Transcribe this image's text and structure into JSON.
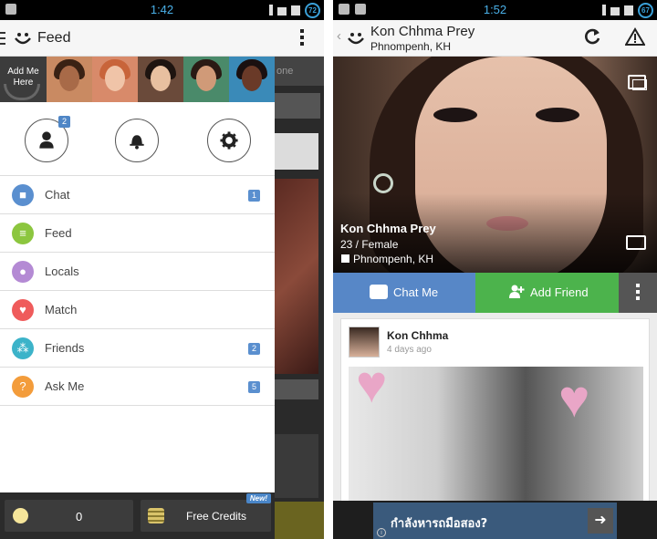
{
  "left": {
    "status": {
      "time": "1:42",
      "battery": "72"
    },
    "appbar": {
      "title": "Feed"
    },
    "background_tab": "one",
    "strip": {
      "add_me": "Add Me Here"
    },
    "quick_actions": {
      "friend_requests_badge": "2"
    },
    "menu": [
      {
        "label": "Chat",
        "icon": "chat-icon",
        "color": "#5a8fcf",
        "badge": "1"
      },
      {
        "label": "Feed",
        "icon": "feed-icon",
        "color": "#8cc63f",
        "badge": ""
      },
      {
        "label": "Locals",
        "icon": "location-icon",
        "color": "#b48ad4",
        "badge": ""
      },
      {
        "label": "Match",
        "icon": "heart-icon",
        "color": "#ef5b5b",
        "badge": ""
      },
      {
        "label": "Friends",
        "icon": "friends-icon",
        "color": "#3cb3c9",
        "badge": "2"
      },
      {
        "label": "Ask Me",
        "icon": "question-icon",
        "color": "#f39c3b",
        "badge": "5"
      }
    ],
    "bottom": {
      "coins": "0",
      "free_credits": "Free Credits",
      "new_tag": "New!"
    }
  },
  "right": {
    "status": {
      "time": "1:52",
      "battery": "67"
    },
    "appbar": {
      "name": "Kon Chhma Prey",
      "location": "Phnompenh, KH"
    },
    "profile": {
      "name": "Kon Chhma Prey",
      "age_gender": "23 / Female",
      "city": "Phnompenh, KH"
    },
    "actions": {
      "chat": "Chat Me",
      "add_friend": "Add Friend"
    },
    "post": {
      "author": "Kon Chhma",
      "time": "4 days ago"
    },
    "ad": {
      "text": "กำลังหารถมือสอง?"
    }
  },
  "colors": {
    "chat_blue": "#5787c7",
    "friend_green": "#4cb34c",
    "accent": "#4ab0e8"
  }
}
